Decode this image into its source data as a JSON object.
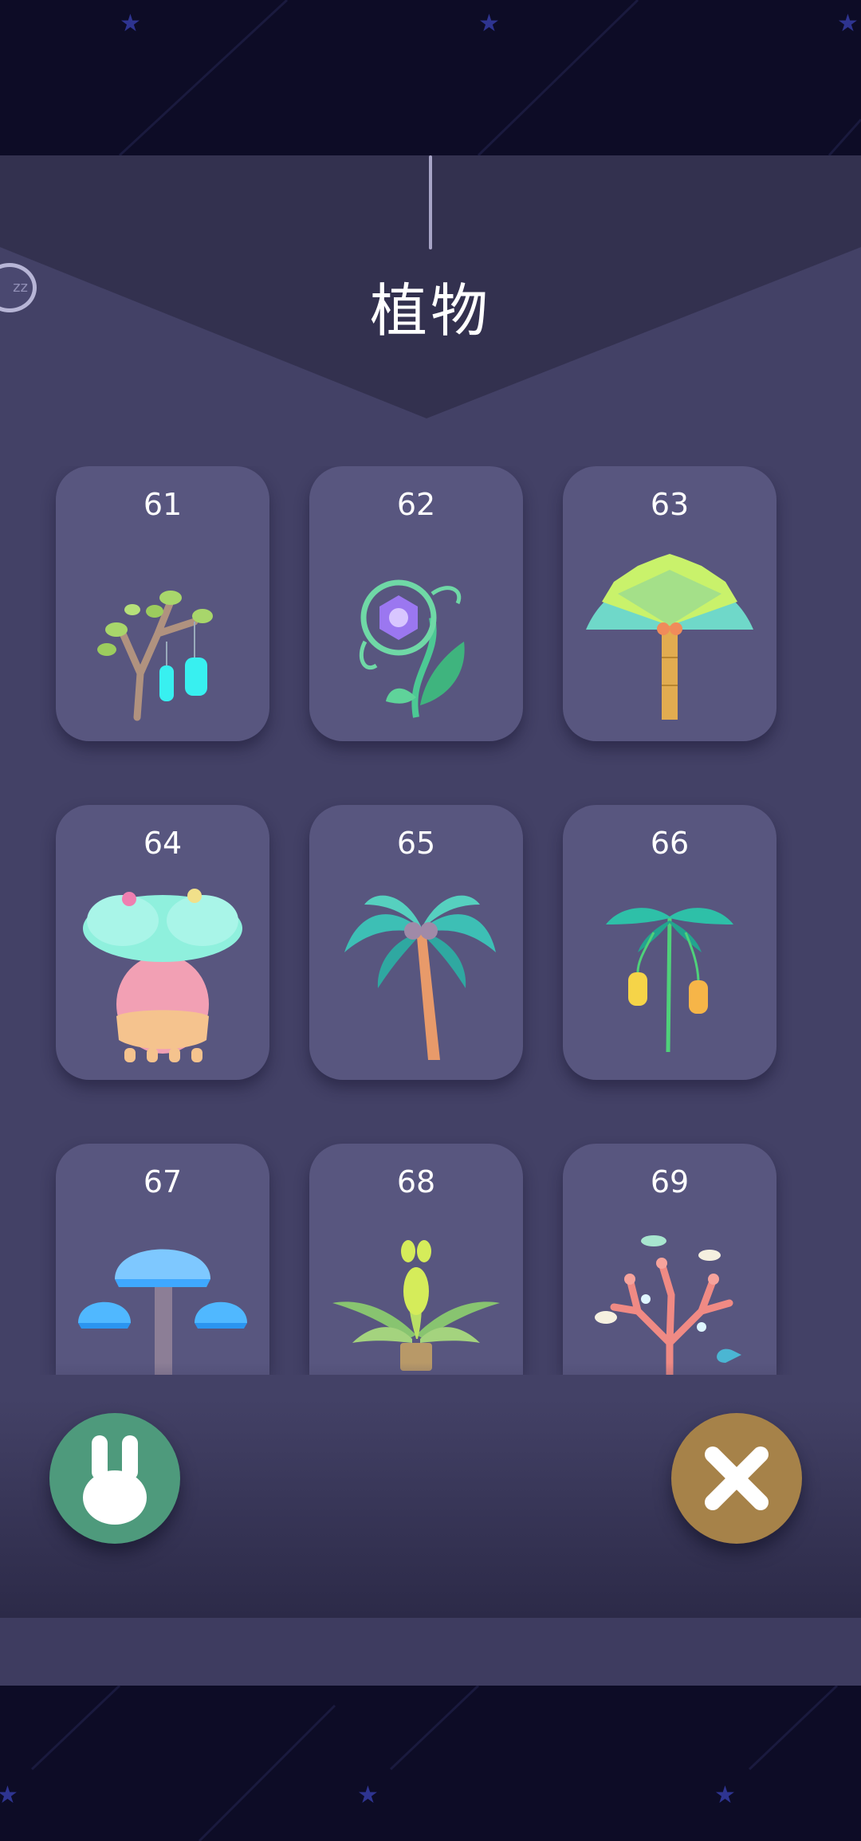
{
  "header": {
    "title": "植物",
    "sleep_badge": "zz"
  },
  "plants": [
    {
      "number": "61",
      "icon": "hanging-glow-tree-icon"
    },
    {
      "number": "62",
      "icon": "crystal-vine-icon"
    },
    {
      "number": "63",
      "icon": "fan-palm-icon"
    },
    {
      "number": "64",
      "icon": "baobab-tree-icon"
    },
    {
      "number": "65",
      "icon": "coconut-palm-icon"
    },
    {
      "number": "66",
      "icon": "pitcher-plant-icon"
    },
    {
      "number": "67",
      "icon": "jellyfish-tree-icon"
    },
    {
      "number": "68",
      "icon": "agave-plant-icon"
    },
    {
      "number": "69",
      "icon": "coral-tree-icon"
    }
  ],
  "buttons": {
    "left": {
      "icon": "rabbit-icon",
      "color": "#4e9a7c"
    },
    "right": {
      "icon": "close-icon",
      "color": "#a68249"
    }
  },
  "colors": {
    "background": "#0d0c26",
    "panel": "#434166",
    "card": "#58567f",
    "star": "#2e3490"
  }
}
